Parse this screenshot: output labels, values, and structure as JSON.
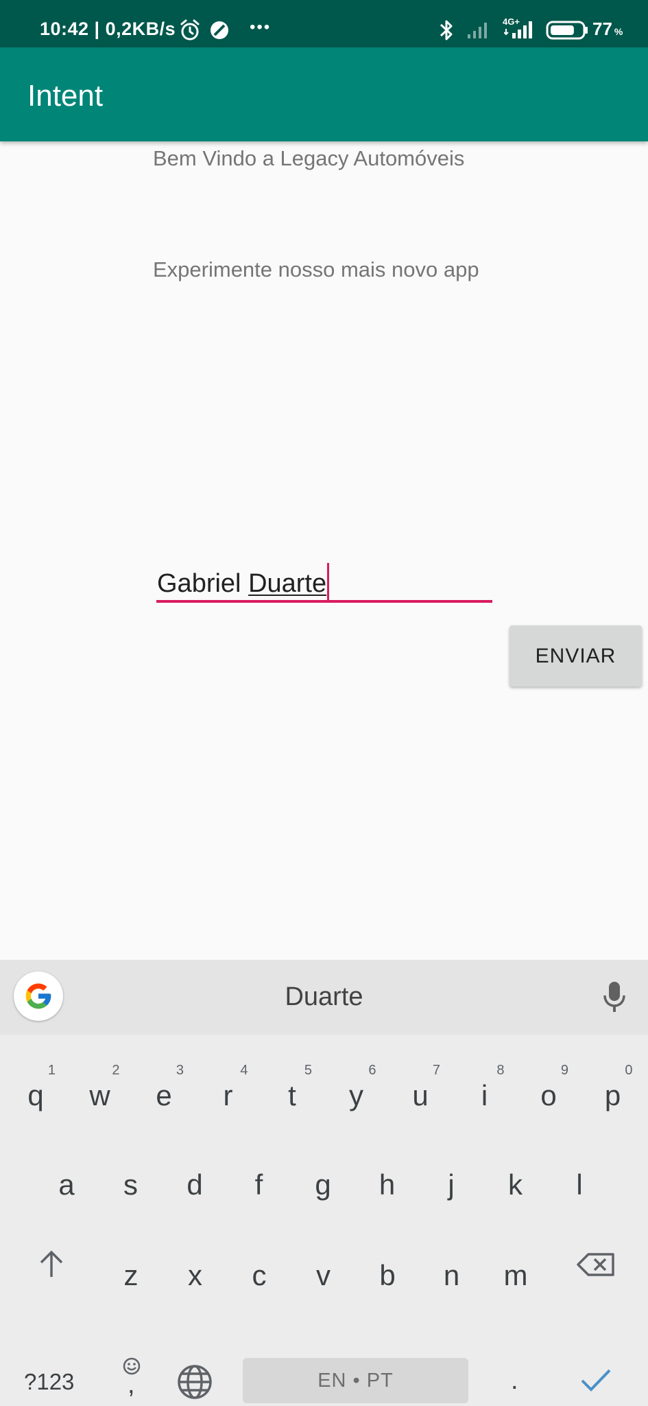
{
  "status_bar": {
    "time_and_speed": "10:42 | 0,2KB/s",
    "more": "•••",
    "network": "4G+",
    "battery_level": 0.77,
    "battery_text": "77",
    "percent": "%"
  },
  "app_bar": {
    "title": "Intent"
  },
  "content": {
    "welcome_text": "Bem Vindo a Legacy Automóveis",
    "subtitle_text": "Experimente nosso mais novo app",
    "name_input": {
      "value_committed": "Gabriel ",
      "value_composing": "Duarte"
    },
    "send_button_label": "ENVIAR"
  },
  "keyboard": {
    "suggestion": "Duarte",
    "row1": [
      {
        "key": "q",
        "hint": "1"
      },
      {
        "key": "w",
        "hint": "2"
      },
      {
        "key": "e",
        "hint": "3"
      },
      {
        "key": "r",
        "hint": "4"
      },
      {
        "key": "t",
        "hint": "5"
      },
      {
        "key": "y",
        "hint": "6"
      },
      {
        "key": "u",
        "hint": "7"
      },
      {
        "key": "i",
        "hint": "8"
      },
      {
        "key": "o",
        "hint": "9"
      },
      {
        "key": "p",
        "hint": "0"
      }
    ],
    "row2": [
      "a",
      "s",
      "d",
      "f",
      "g",
      "h",
      "j",
      "k",
      "l"
    ],
    "row3": [
      "z",
      "x",
      "c",
      "v",
      "b",
      "n",
      "m"
    ],
    "symbols_label": "?123",
    "comma": ",",
    "space_label": "EN • PT",
    "period": ".",
    "accent_color": "#4a90c8",
    "input_accent_color": "#d81b60"
  }
}
